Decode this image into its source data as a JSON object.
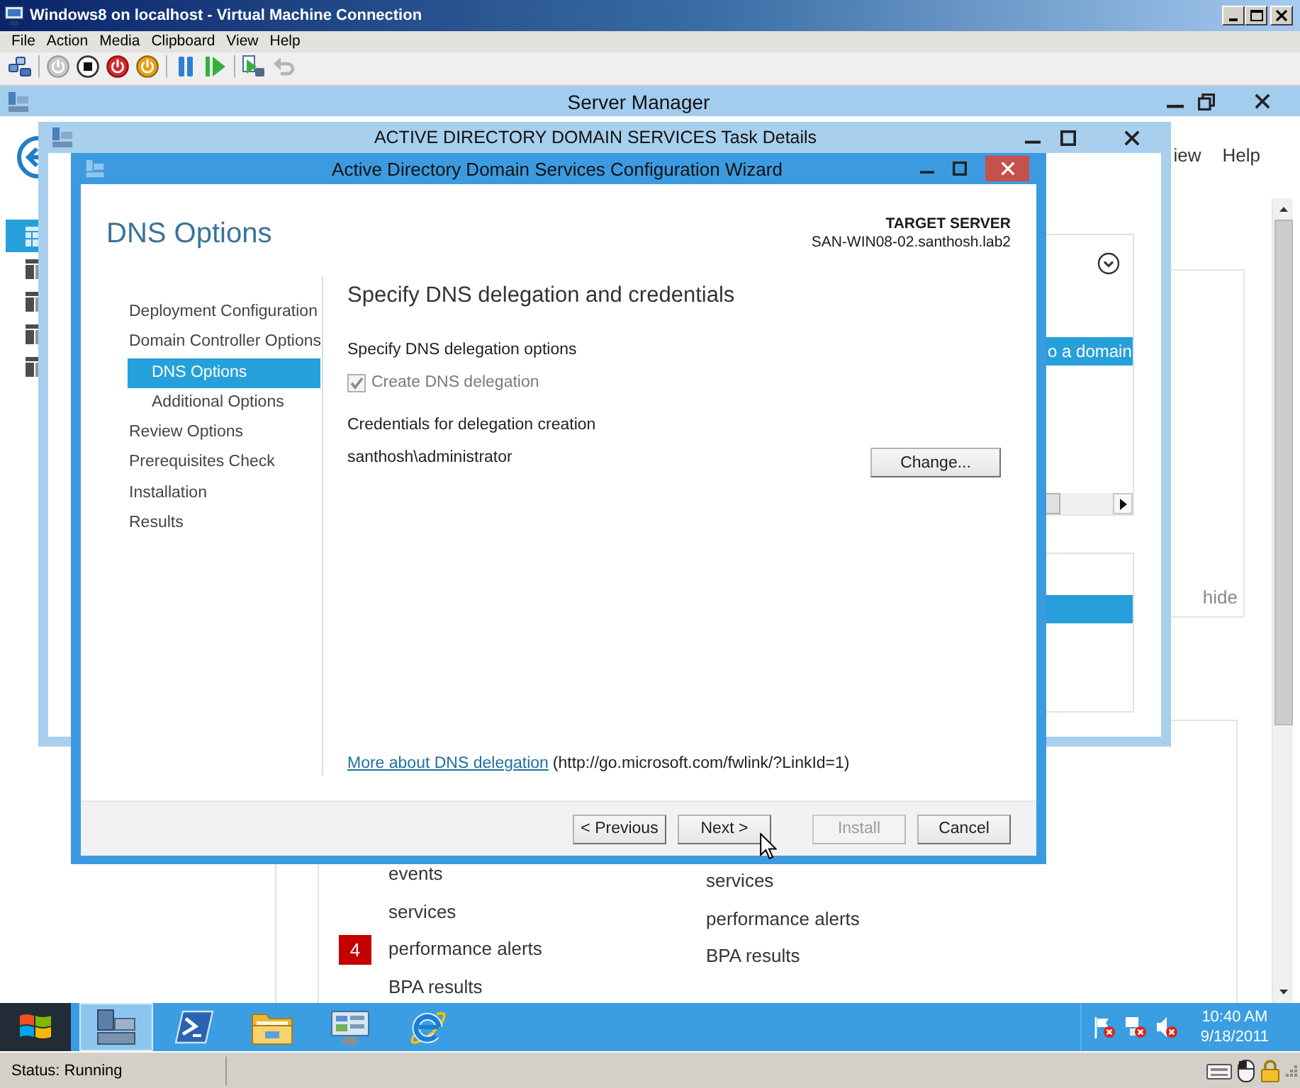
{
  "vm_window": {
    "title": "Windows8 on localhost - Virtual Machine Connection",
    "menu": [
      "File",
      "Action",
      "Media",
      "Clipboard",
      "View",
      "Help"
    ],
    "toolbar": {
      "groups": [
        {
          "buttons": [
            {
              "kind": "keys",
              "disabled": false
            }
          ]
        },
        {
          "buttons": [
            {
              "kind": "start",
              "disabled": true
            },
            {
              "kind": "turn-off",
              "disabled": false
            },
            {
              "kind": "shut-down",
              "disabled": false
            },
            {
              "kind": "save",
              "disabled": false
            }
          ]
        },
        {
          "buttons": [
            {
              "kind": "pause",
              "disabled": false
            },
            {
              "kind": "reset",
              "disabled": false
            }
          ]
        },
        {
          "buttons": [
            {
              "kind": "snapshot",
              "disabled": false
            },
            {
              "kind": "revert",
              "disabled": true
            }
          ]
        }
      ]
    }
  },
  "server_manager": {
    "title": "Server Manager",
    "header_menu": [
      "iew",
      "Help"
    ],
    "nav": [
      {
        "kind": "dashboard",
        "selected": true
      },
      {
        "kind": "server",
        "selected": false
      },
      {
        "kind": "server",
        "selected": false
      },
      {
        "kind": "server",
        "selected": false
      },
      {
        "kind": "server",
        "selected": false
      }
    ],
    "hide_link": "hide",
    "lists": [
      {
        "items": [
          {
            "label": "events"
          },
          {
            "label": "services"
          },
          {
            "label": "performance alerts",
            "badge": "4"
          },
          {
            "label": "BPA results"
          }
        ]
      },
      {
        "items": [
          {
            "label": "services"
          },
          {
            "label": "performance alerts"
          },
          {
            "label": "BPA results"
          }
        ]
      }
    ]
  },
  "task_details": {
    "title": "ACTIVE DIRECTORY DOMAIN SERVICES Task Details",
    "row_text": "o a domain"
  },
  "wizard": {
    "title": "Active Directory Domain Services Configuration Wizard",
    "page_title": "DNS Options",
    "target_label": "TARGET SERVER",
    "target_server": "SAN-WIN08-02.santhosh.lab2",
    "steps": [
      {
        "label": "Deployment Configuration",
        "selected": false
      },
      {
        "label": "Domain Controller Options",
        "selected": false,
        "children": [
          {
            "label": "DNS Options",
            "selected": true
          },
          {
            "label": "Additional Options",
            "selected": false
          }
        ]
      },
      {
        "label": "Review Options",
        "selected": false
      },
      {
        "label": "Prerequisites Check",
        "selected": false
      },
      {
        "label": "Installation",
        "selected": false
      },
      {
        "label": "Results",
        "selected": false
      }
    ],
    "heading": "Specify DNS delegation and credentials",
    "options_label": "Specify DNS delegation options",
    "delegation_checkbox": {
      "label": "Create DNS delegation",
      "checked": true,
      "disabled": true
    },
    "credentials_label": "Credentials for delegation creation",
    "credentials_user": "santhosh\\administrator",
    "change_button": "Change...",
    "help_link": {
      "text": "More about DNS delegation",
      "url": "(http://go.microsoft.com/fwlink/?LinkId=1)"
    },
    "buttons": [
      {
        "label": "< Previous",
        "disabled": false
      },
      {
        "label": "Next >",
        "disabled": false
      },
      {
        "label": "Install",
        "disabled": true
      },
      {
        "label": "Cancel",
        "disabled": false
      }
    ]
  },
  "taskbar": {
    "apps": [
      {
        "kind": "server-manager",
        "selected": true
      },
      {
        "kind": "powershell",
        "selected": false
      },
      {
        "kind": "explorer",
        "selected": false
      },
      {
        "kind": "control-panel",
        "selected": false
      },
      {
        "kind": "browser",
        "selected": false
      }
    ],
    "clock": {
      "time": "10:40 AM",
      "date": "9/18/2011"
    }
  },
  "status_bar": {
    "status": "Status: Running"
  }
}
